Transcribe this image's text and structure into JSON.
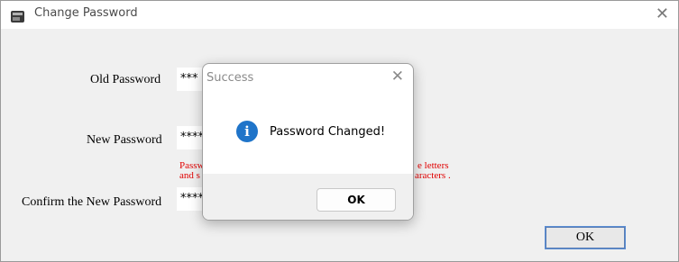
{
  "window": {
    "title": "Change Password",
    "close": "✕"
  },
  "form": {
    "old_label": "Old Password",
    "old_value": "***",
    "new_label": "New Password",
    "new_value": "****",
    "confirm_label": "Confirm the New Password",
    "confirm_value": "****",
    "hint_left_line1": "Passw",
    "hint_left_line2": "and s",
    "hint_right_line1": "e letters",
    "hint_right_line2": "aracters .",
    "ok_label": "OK"
  },
  "dialog": {
    "title": "Success",
    "close": "✕",
    "icon": "info-icon",
    "message": "Password Changed!",
    "ok_label": "OK"
  },
  "colors": {
    "hint": "#e00000",
    "info_icon": "#1f74c9",
    "accent_border": "#5b8ed4"
  }
}
